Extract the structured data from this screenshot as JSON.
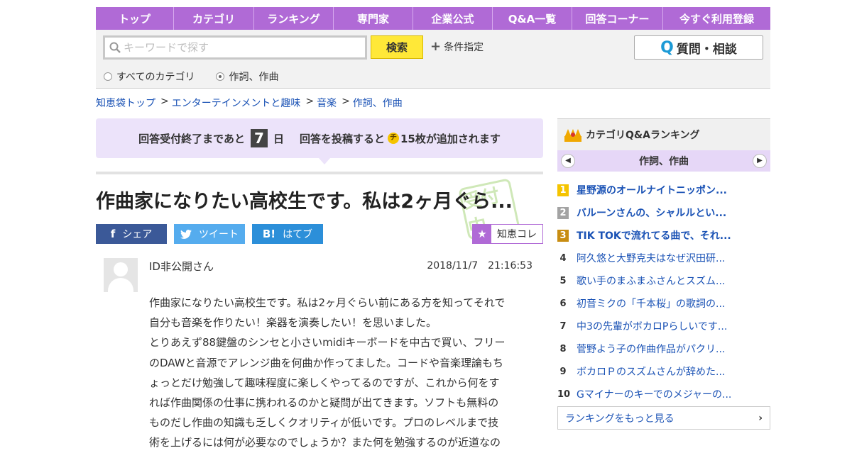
{
  "nav": [
    "トップ",
    "カテゴリ",
    "ランキング",
    "専門家",
    "企業公式",
    "Q&A一覧",
    "回答コーナー",
    "今すぐ利用登録"
  ],
  "search": {
    "placeholder": "キーワードで探す",
    "button": "検索",
    "condition": "条件指定",
    "ask_button": "質問・相談",
    "radio_all": "すべてのカテゴリ",
    "radio_cat": "作詞、作曲",
    "selected": "作詞、作曲"
  },
  "breadcrumb": [
    "知恵袋トップ",
    "エンターテインメントと趣味",
    "音楽",
    "作詞、作曲"
  ],
  "notice": {
    "prefix": "回答受付終了まであと",
    "days": "7",
    "unit": "日",
    "middle": "回答を投稿すると",
    "coin": "チ",
    "suffix": "15枚が追加されます"
  },
  "question": {
    "title": "作曲家になりたい高校生です。私は2ヶ月ぐら...",
    "stamp": "受付中",
    "share_fb": "シェア",
    "share_tw": "ツイート",
    "share_hb": "はてブ",
    "chiekore": "知恵コレ",
    "user": "ID非公開さん",
    "date": "2018/11/7　21:16:53",
    "body": [
      "作曲家になりたい高校生です。私は2ヶ月ぐらい前にある方を知ってそれで",
      "自分も音楽を作りたい！楽器を演奏したい！を思いました。",
      "とりあえず88鍵盤のシンセと小さいmidiキーボードを中古で買い、フリー",
      "のDAWと音源でアレンジ曲を何曲か作ってました。コードや音楽理論もち",
      "ょっとだけ勉強して趣味程度に楽しくやってるのですが、これから何をす",
      "れば作曲関係の仕事に携われるのかと疑問が出てきます。ソフトも無料の",
      "ものだし作曲の知識も乏しくクオリティが低いです。プロのレベルまで技",
      "術を上げるには何が必要なのでしょうか？また何を勉強するのが近道なの"
    ]
  },
  "ranking": {
    "title": "カテゴリQ&Aランキング",
    "category": "作詞、作曲",
    "items": [
      {
        "rank": "1",
        "text": "星野源のオールナイトニッポン..."
      },
      {
        "rank": "2",
        "text": "バルーンさんの、シャルルとい..."
      },
      {
        "rank": "3",
        "text": "TIK TOKで流れてる曲で、それ..."
      },
      {
        "rank": "4",
        "text": "阿久悠と大野克夫はなぜ沢田研..."
      },
      {
        "rank": "5",
        "text": "歌い手のまふまふさんとスズム..."
      },
      {
        "rank": "6",
        "text": "初音ミクの「千本桜」の歌詞の..."
      },
      {
        "rank": "7",
        "text": "中3の先輩がボカロPらしいです..."
      },
      {
        "rank": "8",
        "text": "菅野よう子の作曲作品がパクリ..."
      },
      {
        "rank": "9",
        "text": "ボカロＰのスズムさんが辞めた..."
      },
      {
        "rank": "10",
        "text": "Gマイナーのキーでのメジャーの..."
      }
    ],
    "more": "ランキングをもっと見る"
  }
}
